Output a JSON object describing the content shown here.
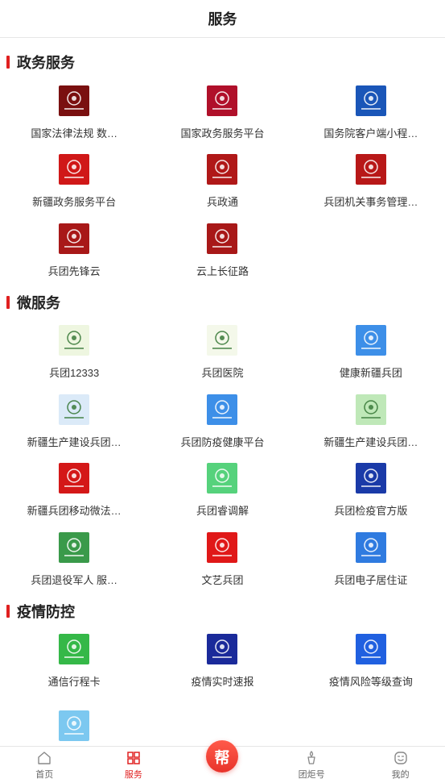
{
  "header": {
    "title": "服务"
  },
  "sections": {
    "gov": {
      "title": "政务服务",
      "items": [
        {
          "label": "国家法律法规 数…",
          "icon": "law-database-icon",
          "bg": "#7a1010"
        },
        {
          "label": "国家政务服务平台",
          "icon": "national-emblem-icon",
          "bg": "#b0102a"
        },
        {
          "label": "国务院客户端小程…",
          "icon": "state-council-icon",
          "bg": "#1a56b8"
        },
        {
          "label": "新疆政务服务平台",
          "icon": "xinjiang-gov-icon",
          "bg": "#d01818"
        },
        {
          "label": "兵政通",
          "icon": "bingzhengtong-icon",
          "bg": "#b01818"
        },
        {
          "label": "兵团机关事务管理…",
          "icon": "affairs-management-icon",
          "bg": "#b81818"
        },
        {
          "label": "兵团先锋云",
          "icon": "vanguard-cloud-icon",
          "bg": "#a81818"
        },
        {
          "label": "云上长征路",
          "icon": "long-march-icon",
          "bg": "#a81818"
        }
      ]
    },
    "micro": {
      "title": "微服务",
      "items": [
        {
          "label": "兵团12333",
          "icon": "hrss-12333-icon",
          "bg": "#eef6e0"
        },
        {
          "label": "兵团医院",
          "icon": "hospital-icon",
          "bg": "#f4f8ea"
        },
        {
          "label": "健康新疆兵团",
          "icon": "health-xinjiang-icon",
          "bg": "#3d8fe8"
        },
        {
          "label": "新疆生产建设兵团…",
          "icon": "medical-insurance-icon",
          "bg": "#dbeaf8"
        },
        {
          "label": "兵团防疫健康平台",
          "icon": "epidemic-health-icon",
          "bg": "#3d8fe8"
        },
        {
          "label": "新疆生产建设兵团…",
          "icon": "corps-nature-icon",
          "bg": "#bfe8b8"
        },
        {
          "label": "新疆兵团移动微法…",
          "icon": "mobile-court-icon",
          "bg": "#d41818"
        },
        {
          "label": "兵团睿调解",
          "icon": "mediation-icon",
          "bg": "#56d27c"
        },
        {
          "label": "兵团检疫官方版",
          "icon": "procuratorate-icon",
          "bg": "#1a3aa8"
        },
        {
          "label": "兵团退役军人 服…",
          "icon": "veterans-icon",
          "bg": "#3a9a4a"
        },
        {
          "label": "文艺兵团",
          "icon": "arts-corps-icon",
          "bg": "#e01818"
        },
        {
          "label": "兵团电子居住证",
          "icon": "residence-permit-icon",
          "bg": "#2f7be0"
        }
      ]
    },
    "epidemic": {
      "title": "疫情防控",
      "items": [
        {
          "label": "通信行程卡",
          "icon": "travel-card-icon",
          "bg": "#35b848"
        },
        {
          "label": "疫情实时速报",
          "icon": "epidemic-news-icon",
          "bg": "#1a2a9a"
        },
        {
          "label": "疫情风险等级查询",
          "icon": "risk-level-icon",
          "bg": "#2060e0"
        },
        {
          "label": "",
          "icon": "epidemic-shield-icon",
          "bg": "#7cc8f0"
        }
      ]
    }
  },
  "tabbar": {
    "home": "首页",
    "services": "服务",
    "help": "帮",
    "torch": "团炬号",
    "mine": "我的"
  },
  "colors": {
    "accent": "#e02020"
  }
}
